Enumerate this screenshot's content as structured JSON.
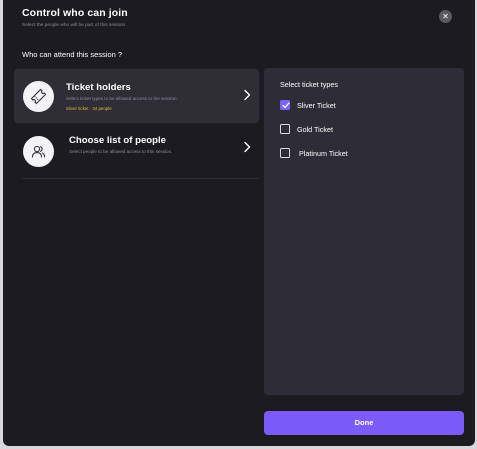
{
  "modal": {
    "title": "Control who can join",
    "subtitle": "Select the people who will be part of this session.",
    "close_icon": "close-icon"
  },
  "attendance": {
    "label": "Who can attend this session ?",
    "options": [
      {
        "title": "Ticket holders",
        "description": "Select ticket types to be allowed access to the session",
        "tag": "Sliver ticket · 34 people",
        "icon": "ticket-icon",
        "selected": true
      },
      {
        "title": "Choose list of people",
        "description": "Select people to be allowed access to this session.",
        "icon": "people-icon",
        "selected": false
      }
    ]
  },
  "ticket_panel": {
    "title": "Select ticket types",
    "tickets": [
      {
        "label": "Sliver Ticket",
        "checked": true
      },
      {
        "label": "Gold Ticket",
        "checked": false
      },
      {
        "label": "Platinum Ticket",
        "checked": false
      }
    ]
  },
  "footer": {
    "done_label": "Done"
  },
  "colors": {
    "background": "#1c1b20",
    "panel": "#2e2d35",
    "accent": "#7b5cfa",
    "tag": "#e0b947"
  }
}
